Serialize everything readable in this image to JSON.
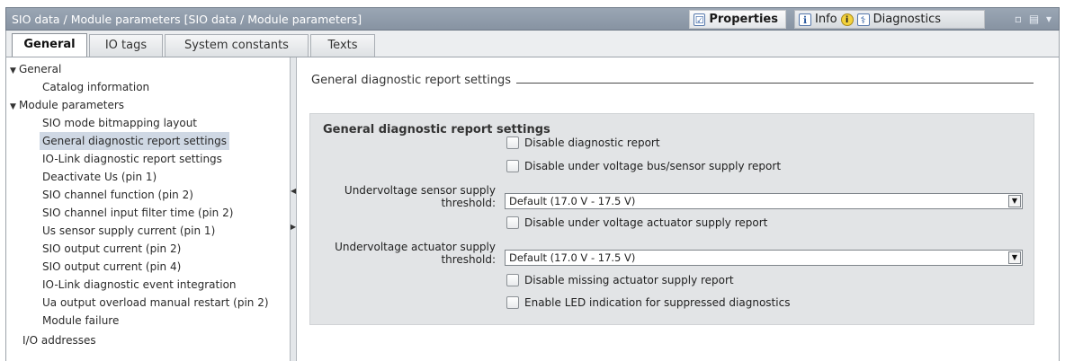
{
  "window": {
    "title": "SIO data / Module parameters [SIO data / Module parameters]",
    "properties_label": "Properties",
    "info_label": "Info",
    "info_badge": "i",
    "diagnostics_label": "Diagnostics",
    "tools_glyphs": "▫ ▤ ▾"
  },
  "tabs": [
    {
      "label": "General",
      "active": true
    },
    {
      "label": "IO tags",
      "active": false
    },
    {
      "label": "System constants",
      "active": false
    },
    {
      "label": "Texts",
      "active": false
    }
  ],
  "tree": {
    "general": "General",
    "catalog_information": "Catalog information",
    "module_parameters": "Module parameters",
    "items": [
      "SIO mode bitmapping layout",
      "General diagnostic report settings",
      "IO-Link diagnostic report settings",
      "Deactivate Us (pin 1)",
      "SIO channel function (pin 2)",
      "SIO channel input filter time (pin 2)",
      "Us sensor supply current (pin 1)",
      "SIO output current (pin 2)",
      "SIO output current (pin 4)",
      "IO-Link diagnostic event integration",
      "Ua output overload manual restart (pin 2)",
      "Module failure"
    ],
    "selected_index": 1,
    "io_addresses": "I/O addresses"
  },
  "content": {
    "section_header": "General diagnostic report settings",
    "panel_title": "General diagnostic report settings",
    "cb_disable_diag": "Disable diagnostic report",
    "cb_disable_uv_bus": "Disable under voltage bus/sensor supply report",
    "label_uv_sensor_1": "Undervoltage sensor supply",
    "label_uv_sensor_2": "threshold:",
    "select_uv_sensor": "Default (17.0 V - 17.5 V)",
    "cb_disable_uv_act": "Disable under voltage actuator supply report",
    "label_uv_act_1": "Undervoltage actuator supply",
    "label_uv_act_2": "threshold:",
    "select_uv_act": "Default (17.0 V - 17.5 V)",
    "cb_disable_missing_act": "Disable missing actuator supply report",
    "cb_enable_led": "Enable LED indication for suppressed diagnostics"
  }
}
